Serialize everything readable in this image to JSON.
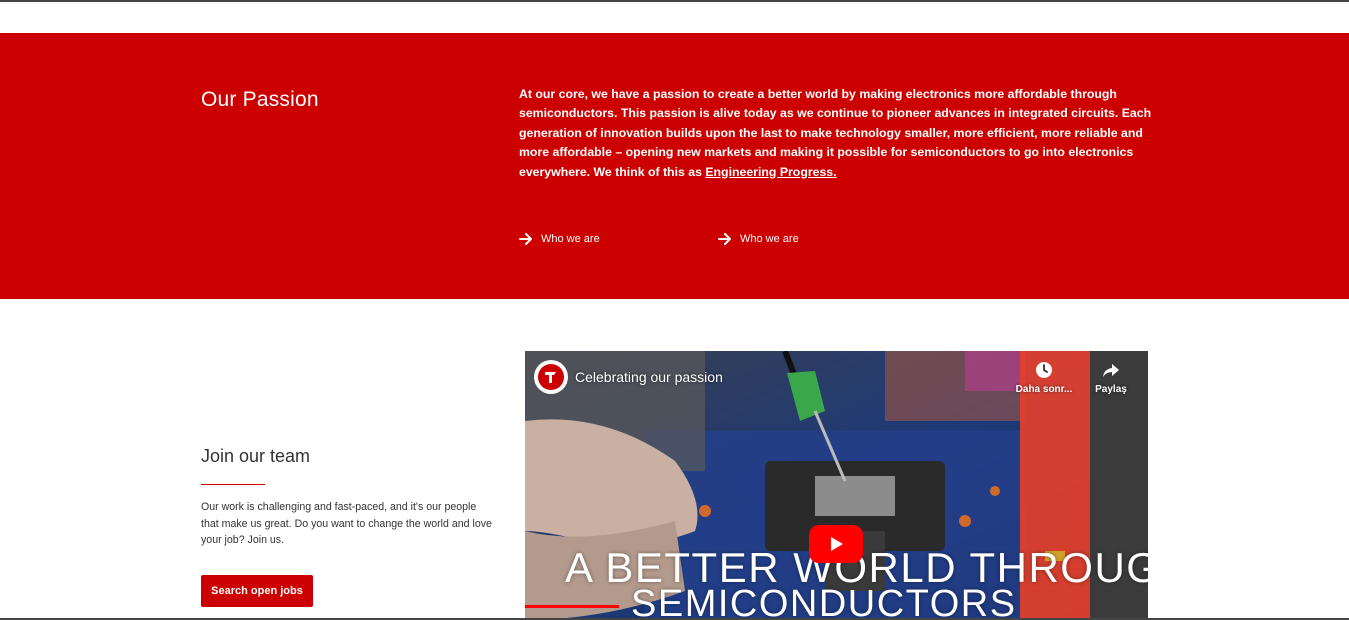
{
  "passion": {
    "title": "Our Passion",
    "text": "At our core, we have a passion to create a better world by making electronics more affordable through semiconductors. This passion is alive today as we continue to pioneer advances in integrated circuits. Each generation of innovation builds upon the last to make technology smaller, more efficient, more reliable and more affordable – opening new markets and making it possible for semiconductors to go into electronics everywhere. We think of this as ",
    "link": "Engineering Progress.",
    "links": [
      {
        "label": "Who we are"
      },
      {
        "label": "Who we are"
      }
    ],
    "bg_color": "#cc0000"
  },
  "join": {
    "title": "Join our team",
    "text": "Our work is challenging and fast-paced, and it's our people that make us great. Do you want to change the world and love your job? Join us.",
    "button": "Search open jobs"
  },
  "video": {
    "title": "Celebrating our passion",
    "watch_later": "Daha sonr...",
    "share": "Paylaş",
    "overlay_line1": "A BETTER WORLD THROUGH",
    "overlay_line2": "SEMICONDUCTORS",
    "logo_icon": "ti-logo-icon",
    "play_color": "#ff0000"
  }
}
